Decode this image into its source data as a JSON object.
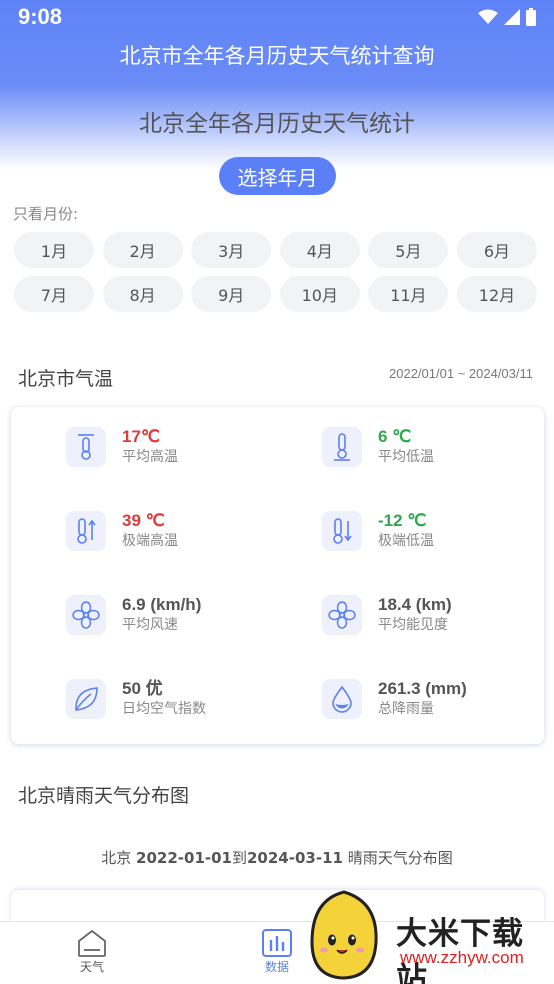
{
  "status_bar": {
    "time": "9:08"
  },
  "app_title": "北京市全年各月历史天气统计查询",
  "page_title": "北京全年各月历史天气统计",
  "select_button": "选择年月",
  "month_filter": {
    "label": "只看月份:",
    "months": [
      "1月",
      "2月",
      "3月",
      "4月",
      "5月",
      "6月",
      "7月",
      "8月",
      "9月",
      "10月",
      "11月",
      "12月"
    ]
  },
  "temperature_section": {
    "title": "北京市气温",
    "date_range": "2022/01/01 ~ 2024/03/11"
  },
  "stats": {
    "avg_high": {
      "value": "17℃",
      "label": "平均高温",
      "color": "#e03a3a"
    },
    "avg_low": {
      "value": "6 ℃",
      "label": "平均低温",
      "color": "#2fa84f"
    },
    "extreme_high": {
      "value": "39 ℃",
      "label": "极端高温",
      "color": "#e03a3a"
    },
    "extreme_low": {
      "value": "-12 ℃",
      "label": "极端低温",
      "color": "#2fa84f"
    },
    "avg_wind": {
      "value": "6.9 (km/h)",
      "label": "平均风速",
      "color": "#555555"
    },
    "avg_visibility": {
      "value": "18.4 (km)",
      "label": "平均能见度",
      "color": "#555555"
    },
    "aqi": {
      "value": "50 优",
      "label": "日均空气指数",
      "color": "#555555"
    },
    "rainfall": {
      "value": "261.3 (mm)",
      "label": "总降雨量",
      "color": "#555555"
    }
  },
  "weather_section": {
    "title": "北京晴雨天气分布图",
    "caption_city": "北京 ",
    "caption_start": "2022-01-01",
    "caption_to": "到",
    "caption_end": "2024-03-11",
    "caption_suffix": " 晴雨天气分布图"
  },
  "bottom_nav": {
    "weather": "天气",
    "data": "数据"
  },
  "watermark": {
    "brand": "大米下载站",
    "url": "www.zzhyw.com"
  },
  "colors": {
    "accent": "#5b7ff6",
    "header": "#6a8cf7",
    "icon": "#5b7ff6"
  }
}
